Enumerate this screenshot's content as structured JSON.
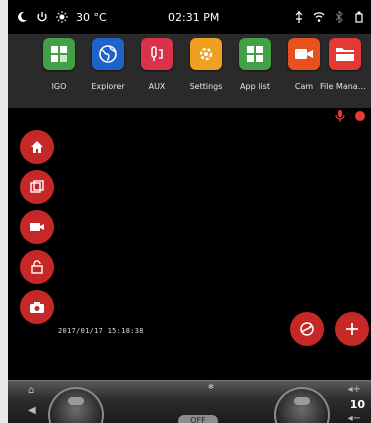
{
  "status": {
    "temperature": "30 °C",
    "time": "02:31 PM"
  },
  "apps": [
    {
      "label": "IGO",
      "icon": "grid-icon",
      "color": "#43a047"
    },
    {
      "label": "Explorer",
      "icon": "globe-icon",
      "color": "#1e63c9"
    },
    {
      "label": "AUX",
      "icon": "aux-icon",
      "color": "#d9334a"
    },
    {
      "label": "Settings",
      "icon": "gear-icon",
      "color": "#f0a020"
    },
    {
      "label": "App list",
      "icon": "apps-icon",
      "color": "#43a047"
    },
    {
      "label": "Cam",
      "icon": "camera-icon",
      "color": "#e8501e"
    },
    {
      "label": "File Manag...",
      "icon": "folder-icon",
      "color": "#e53935"
    }
  ],
  "side_buttons": [
    "home-icon",
    "pages-icon",
    "video-icon",
    "lock-icon",
    "camera-icon"
  ],
  "timestamp": "2017/01/17  15:18:38",
  "climate": {
    "temperature": "10",
    "off_label": "OFF"
  },
  "colors": {
    "accent": "#c62828",
    "panel": "#2a2a2a"
  }
}
